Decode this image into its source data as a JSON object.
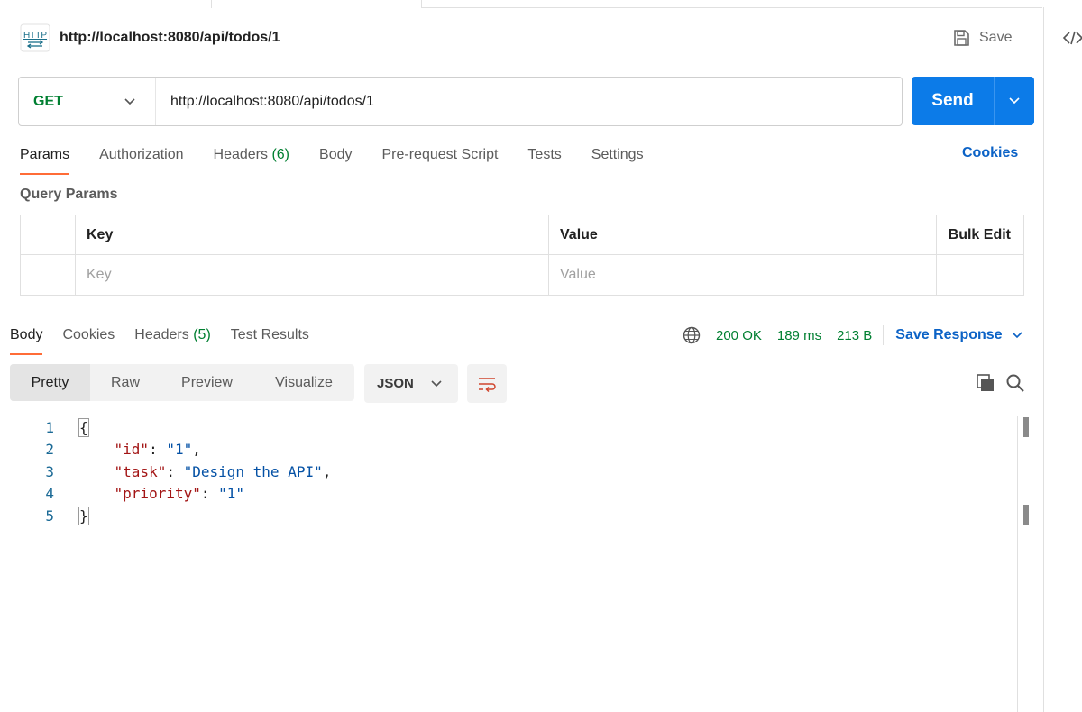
{
  "request": {
    "title": "http://localhost:8080/api/todos/1",
    "save_label": "Save",
    "method": "GET",
    "url": "http://localhost:8080/api/todos/1",
    "send_label": "Send"
  },
  "request_tabs": [
    {
      "label": "Params"
    },
    {
      "label": "Authorization"
    },
    {
      "label": "Headers",
      "count": "(6)"
    },
    {
      "label": "Body"
    },
    {
      "label": "Pre-request Script"
    },
    {
      "label": "Tests"
    },
    {
      "label": "Settings"
    }
  ],
  "cookies_label": "Cookies",
  "query_params": {
    "title": "Query Params",
    "columns": [
      "Key",
      "Value",
      "Bulk Edit"
    ],
    "placeholders": {
      "key": "Key",
      "value": "Value"
    }
  },
  "response_tabs": [
    {
      "label": "Body"
    },
    {
      "label": "Cookies"
    },
    {
      "label": "Headers",
      "count": "(5)"
    },
    {
      "label": "Test Results"
    }
  ],
  "response_meta": {
    "status": "200 OK",
    "time": "189 ms",
    "size": "213 B",
    "save_response_label": "Save Response"
  },
  "view_modes": [
    "Pretty",
    "Raw",
    "Preview",
    "Visualize"
  ],
  "format": "JSON",
  "code_lines": [
    {
      "n": "1"
    },
    {
      "n": "2"
    },
    {
      "n": "3"
    },
    {
      "n": "4"
    },
    {
      "n": "5"
    }
  ],
  "json_body": {
    "open": "{",
    "close": "}",
    "id_key": "\"id\"",
    "id_val": "\"1\"",
    "task_key": "\"task\"",
    "task_val": "\"Design the API\"",
    "priority_key": "\"priority\"",
    "priority_val": "\"1\""
  },
  "colors": {
    "accent_orange": "#ff6c37",
    "send_blue": "#0c7be8",
    "link_blue": "#0b62c6",
    "success_green": "#007f31"
  },
  "icons": [
    "http-icon",
    "save-icon",
    "code-icon",
    "chevron-down-icon",
    "globe-icon",
    "wrap-icon",
    "copy-icon",
    "search-icon"
  ]
}
